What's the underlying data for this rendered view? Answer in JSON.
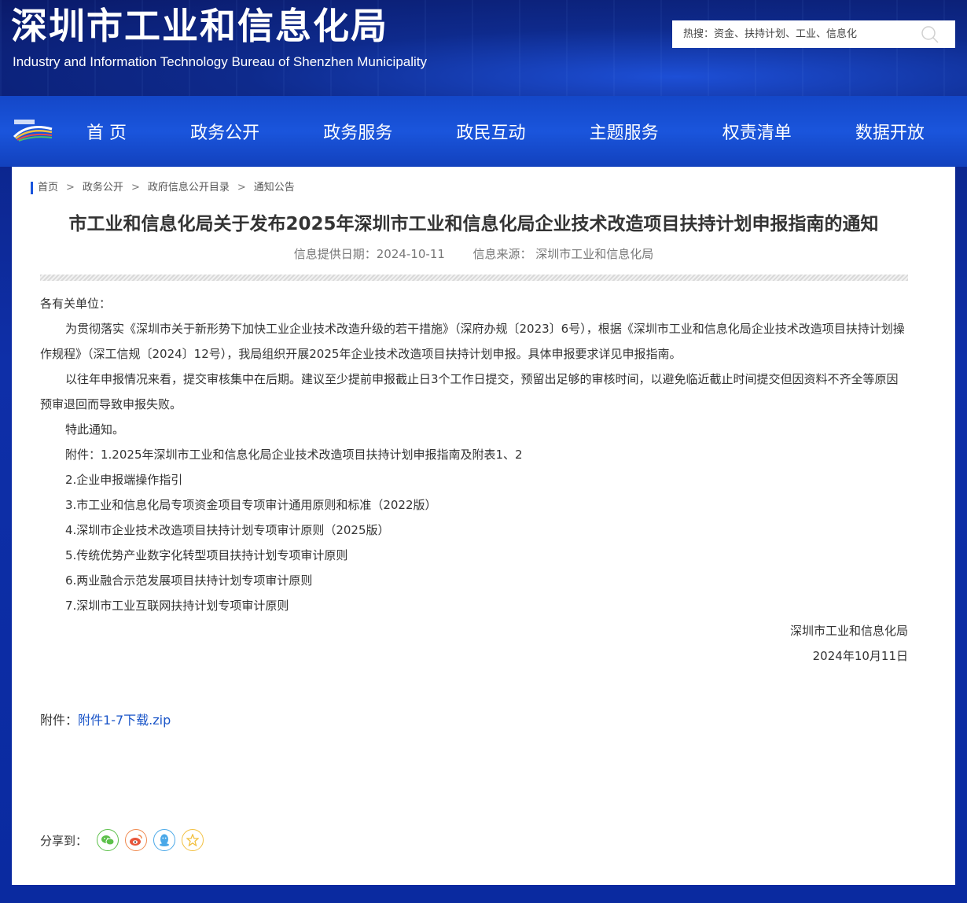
{
  "header": {
    "site_title": "深圳市工业和信息化局",
    "site_subtitle": "Industry and Information Technology Bureau of Shenzhen Municipality",
    "search": {
      "placeholder": "热搜：资金、扶持计划、工业、信息化",
      "button_icon": "search-icon"
    }
  },
  "nav": {
    "logo_icon": "city-logo-icon",
    "items": [
      "首 页",
      "政务公开",
      "政务服务",
      "政民互动",
      "主题服务",
      "权责清单",
      "数据开放"
    ]
  },
  "breadcrumb": {
    "items": [
      "首页",
      "政务公开",
      "政府信息公开目录",
      "通知公告"
    ],
    "separator": ">"
  },
  "article": {
    "title": "市工业和信息化局关于发布2025年深圳市工业和信息化局企业技术改造项目扶持计划申报指南的通知",
    "date_label": "信息提供日期：2024-10-11",
    "source_label": "信息来源：  深圳市工业和信息化局",
    "salutation": "各有关单位：",
    "paragraph1": "为贯彻落实《深圳市关于新形势下加快工业企业技术改造升级的若干措施》（深府办规〔2023〕6号），根据《深圳市工业和信息化局企业技术改造项目扶持计划操作规程》（深工信规〔2024〕12号），我局组织开展2025年企业技术改造项目扶持计划申报。具体申报要求详见申报指南。",
    "paragraph2": "以往年申报情况来看，提交审核集中在后期。建议至少提前申报截止日3个工作日提交，预留出足够的审核时间，以避免临近截止时间提交但因资料不齐全等原因预审退回而导致申报失败。",
    "notice": "特此通知。",
    "attachments": [
      "附件：1.2025年深圳市工业和信息化局企业技术改造项目扶持计划申报指南及附表1、2",
      "2.企业申报端操作指引",
      "3.市工业和信息化局专项资金项目专项审计通用原则和标准（2022版）",
      "4.深圳市企业技术改造项目扶持计划专项审计原则（2025版）",
      "5.传统优势产业数字化转型项目扶持计划专项审计原则",
      "6.两业融合示范发展项目扶持计划专项审计原则",
      "7.深圳市工业互联网扶持计划专项审计原则"
    ],
    "signature": "深圳市工业和信息化局",
    "sign_date": "2024年10月11日"
  },
  "download": {
    "label": "附件：",
    "link_text": "附件1-7下载.zip"
  },
  "share": {
    "label": "分享到：",
    "icons": [
      "wechat-icon",
      "weibo-icon",
      "qq-icon",
      "favorite-icon"
    ],
    "colors": {
      "wechat": "#5cc04a",
      "weibo": "#f08a50",
      "qq": "#4aa8e8",
      "favorite": "#f2c040"
    }
  },
  "colors": {
    "nav_bg": "#1a55dc",
    "link": "#1a55c8",
    "breadcrumb_accent": "#1a55dc"
  }
}
